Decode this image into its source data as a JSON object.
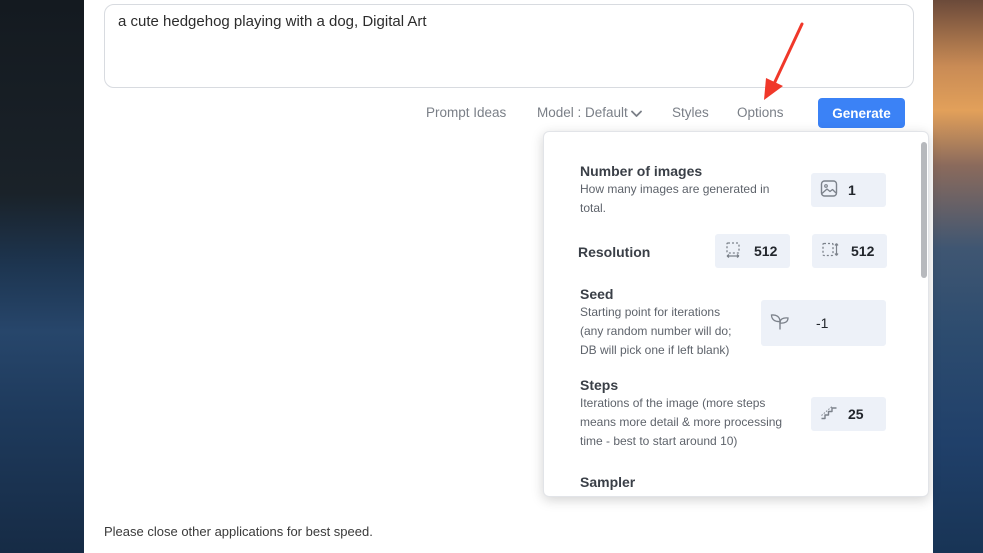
{
  "prompt": {
    "text": "a cute hedgehog playing with a dog, Digital Art"
  },
  "toolbar": {
    "prompt_ideas": "Prompt Ideas",
    "model": "Model : Default",
    "styles": "Styles",
    "options": "Options",
    "generate": "Generate"
  },
  "options": {
    "number_of_images": {
      "title": "Number of images",
      "desc_line1": "How many images are generated in",
      "desc_line2": "total.",
      "value": "1",
      "icon": "image-icon"
    },
    "resolution": {
      "title": "Resolution",
      "width": "512",
      "height": "512",
      "width_icon": "width-icon",
      "height_icon": "height-icon"
    },
    "seed": {
      "title": "Seed",
      "desc_line1": "Starting point for iterations",
      "desc_line2": "(any random number will do;",
      "desc_line3": "DB will pick one if left blank)",
      "value": "-1",
      "icon": "sprout-icon"
    },
    "steps": {
      "title": "Steps",
      "desc_line1": "Iterations of the image (more steps",
      "desc_line2": "means more detail & more processing",
      "desc_line3": "time - best to start around 10)",
      "value": "25",
      "icon": "stairs-icon"
    },
    "sampler": {
      "title": "Sampler"
    }
  },
  "footer": {
    "note": "Please close other applications for best speed."
  },
  "colors": {
    "accent": "#3b82f6",
    "field_bg": "#edf1f8",
    "annotation_arrow": "#f0382a"
  }
}
